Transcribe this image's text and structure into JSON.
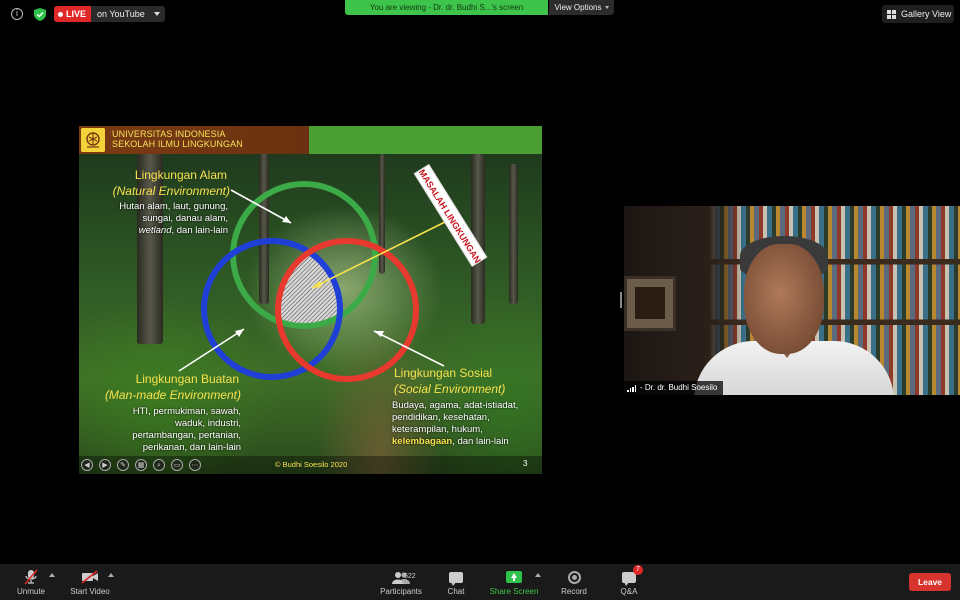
{
  "topbar": {
    "live_badge": "LIVE",
    "live_destination": "on YouTube",
    "viewing_banner": "You are viewing - Dr. dr. Budhi S...'s screen",
    "view_options": "View Options",
    "gallery_view": "Gallery View"
  },
  "slide": {
    "header_line1": "UNIVERSITAS INDONESIA",
    "header_line2": "SEKOLAH ILMU LINGKUNGAN",
    "natural": {
      "title": "Lingkungan Alam",
      "subtitle": "(Natural Environment)",
      "line1": "Hutan alam, laut, gunung,",
      "line2": "sungai, danau alam,",
      "line3_italic": "wetland",
      "line3_rest": ", dan lain-lain"
    },
    "manmade": {
      "title": "Lingkungan Buatan",
      "subtitle": "(Man-made Environment)",
      "line1": "HTI, permukiman, sawah,",
      "line2": "waduk, industri,",
      "line3": "pertambangan, pertanian,",
      "line4": "perikanan, dan lain-lain"
    },
    "social": {
      "title": "Lingkungan Sosial",
      "subtitle": "(Social Environment)",
      "line1": "Budaya, agama, adat-istiadat,",
      "line2": "pendidikan, kesehatan,",
      "line3": "keterampilan, hukum,",
      "line4_highlight": "kelembagaan",
      "line4_rest": ", dan lain-lain"
    },
    "masalah_label": "MASALAH LINGKUNGAN",
    "copyright": "© Budhi Soesilo 2020",
    "page_number": "3"
  },
  "speaker": {
    "name": "- Dr. dr. Budhi Soesilo"
  },
  "toolbar": {
    "unmute": "Unmute",
    "start_video": "Start Video",
    "participants": "Participants",
    "participants_count": "522",
    "chat": "Chat",
    "share_screen": "Share Screen",
    "record": "Record",
    "qa": "Q&A",
    "qa_badge": "7",
    "leave": "Leave"
  },
  "colors": {
    "live_red": "#e02828",
    "banner_green": "#3ec44a",
    "share_green": "#2ec24a",
    "leave_red": "#d7332f",
    "circle_green": "#3daa48",
    "circle_blue": "#1f3fd6",
    "circle_red": "#e8392e",
    "slide_yellow": "#f7e24e"
  },
  "icons": [
    "info-icon",
    "shield-check-icon",
    "grid-icon",
    "microphone-muted-icon",
    "video-off-icon",
    "participants-icon",
    "chat-icon",
    "share-screen-icon",
    "record-icon",
    "qa-icon",
    "signal-icon"
  ]
}
